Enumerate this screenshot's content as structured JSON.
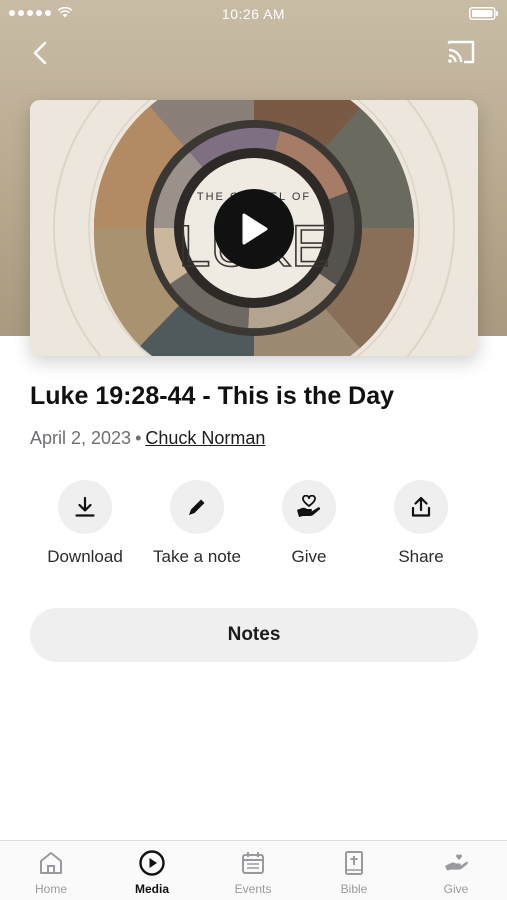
{
  "status_bar": {
    "time": "10:26 AM"
  },
  "nav": {
    "back_icon": "chevron-left-icon",
    "cast_icon": "cast-icon"
  },
  "media": {
    "artwork_text_line1": "THE GOSPEL OF",
    "artwork_text_line2": "LUKE",
    "play_icon": "play-icon"
  },
  "sermon": {
    "title": "Luke 19:28-44 - This is the Day",
    "date": "April 2, 2023",
    "separator": "•",
    "speaker": "Chuck Norman"
  },
  "actions": [
    {
      "label": "Download",
      "icon": "download-icon"
    },
    {
      "label": "Take a note",
      "icon": "pencil-icon"
    },
    {
      "label": "Give",
      "icon": "hand-heart-icon"
    },
    {
      "label": "Share",
      "icon": "share-icon"
    }
  ],
  "notes_button": {
    "label": "Notes"
  },
  "tab_bar": {
    "active": "Media",
    "tabs": [
      {
        "label": "Home",
        "icon": "home-icon"
      },
      {
        "label": "Media",
        "icon": "play-circle-icon"
      },
      {
        "label": "Events",
        "icon": "calendar-icon"
      },
      {
        "label": "Bible",
        "icon": "bible-icon"
      },
      {
        "label": "Give",
        "icon": "give-icon"
      }
    ]
  },
  "colors": {
    "hero_background": "#b8a98f",
    "button_background": "#efeff0",
    "active_tab": "#111111",
    "inactive_tab": "#9a9a9e"
  }
}
